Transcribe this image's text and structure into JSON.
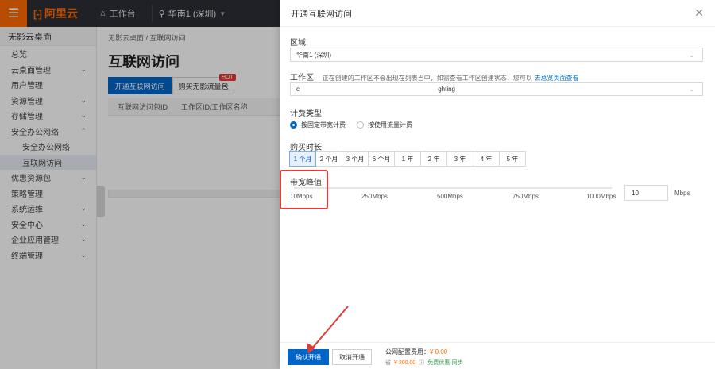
{
  "topbar": {
    "logo_text": "阿里云",
    "workbench_label": "工作台",
    "region_label": "华南1 (深圳)"
  },
  "sidebar": {
    "title": "无影云桌面",
    "items": [
      {
        "label": "总览",
        "expandable": false
      },
      {
        "label": "云桌面管理",
        "expandable": true
      },
      {
        "label": "用户管理",
        "expandable": false
      },
      {
        "label": "资源管理",
        "expandable": true
      },
      {
        "label": "存储管理",
        "expandable": true
      },
      {
        "label": "安全办公网络",
        "expandable": true,
        "expanded": true
      },
      {
        "label": "安全办公网络",
        "sub": true
      },
      {
        "label": "互联网访问",
        "sub": true,
        "active": true
      },
      {
        "label": "优惠资源包",
        "expandable": true
      },
      {
        "label": "策略管理",
        "expandable": false
      },
      {
        "label": "系统运维",
        "expandable": true
      },
      {
        "label": "安全中心",
        "expandable": true
      },
      {
        "label": "企业应用管理",
        "expandable": true
      },
      {
        "label": "终端管理",
        "expandable": true
      }
    ]
  },
  "main": {
    "breadcrumb": "无影云桌面 / 互联网访问",
    "title": "互联网访问",
    "open_button": "开通互联网访问",
    "buy_button": "购买无影流量包",
    "hot_badge": "HOT",
    "columns": [
      "互联网访问包ID",
      "工作区ID/工作区名称"
    ]
  },
  "drawer": {
    "title": "开通互联网访问",
    "region_label": "区域",
    "region_value": "华南1 (深圳)",
    "workspace_label": "工作区",
    "workspace_hint": "正在创建的工作区不会出现在列表当中，如需查看工作区创建状态，您可以",
    "workspace_link": "去总览页面查看",
    "workspace_value_prefix": "c",
    "workspace_value_suffix": "ghting",
    "billing_label": "计费类型",
    "billing_options": [
      {
        "label": "按固定带宽计费",
        "selected": true
      },
      {
        "label": "按使用流量计费",
        "selected": false
      }
    ],
    "duration_label": "购买时长",
    "durations": [
      "1 个月",
      "2 个月",
      "3 个月",
      "6 个月",
      "1 年",
      "2 年",
      "3 年",
      "4 年",
      "5 年"
    ],
    "duration_selected": "1 个月",
    "bandwidth_label": "带宽峰值",
    "bandwidth_ticks": [
      "10Mbps",
      "250Mbps",
      "500Mbps",
      "750Mbps",
      "1000Mbps"
    ],
    "bandwidth_value": "10",
    "bandwidth_unit": "Mbps",
    "confirm_button": "确认开通",
    "cancel_button": "取消开通",
    "fee_label": "公网配置费用：",
    "fee_value": "¥ 0.00",
    "fee_original_prefix": "省",
    "fee_original": "¥ 200.00",
    "fee_promo": "免费优惠·同步"
  },
  "colors": {
    "primary": "#0064c8",
    "brand": "#ff6a00",
    "annotation": "#e53935"
  }
}
